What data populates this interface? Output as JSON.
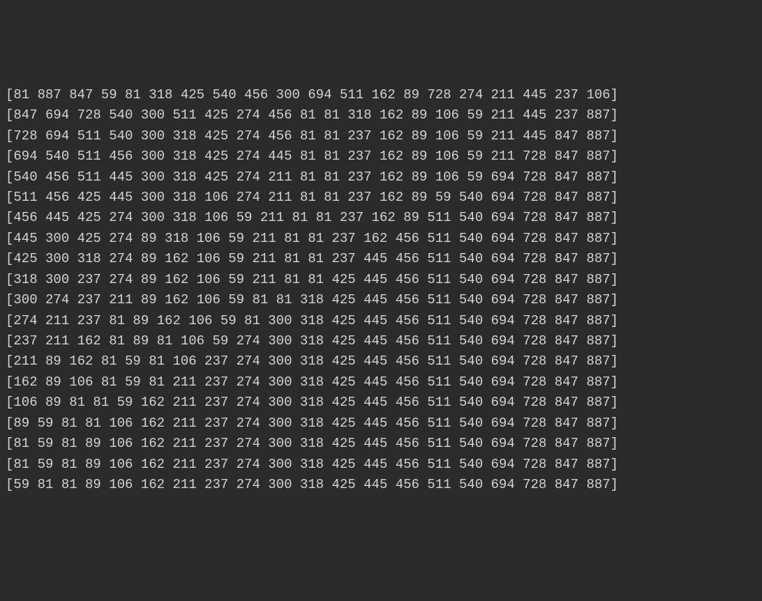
{
  "terminal": {
    "lines": [
      "[81 887 847 59 81 318 425 540 456 300 694 511 162 89 728 274 211 445 237 106]",
      "[847 694 728 540 300 511 425 274 456 81 81 318 162 89 106 59 211 445 237 887]",
      "[728 694 511 540 300 318 425 274 456 81 81 237 162 89 106 59 211 445 847 887]",
      "[694 540 511 456 300 318 425 274 445 81 81 237 162 89 106 59 211 728 847 887]",
      "[540 456 511 445 300 318 425 274 211 81 81 237 162 89 106 59 694 728 847 887]",
      "[511 456 425 445 300 318 106 274 211 81 81 237 162 89 59 540 694 728 847 887]",
      "[456 445 425 274 300 318 106 59 211 81 81 237 162 89 511 540 694 728 847 887]",
      "[445 300 425 274 89 318 106 59 211 81 81 237 162 456 511 540 694 728 847 887]",
      "[425 300 318 274 89 162 106 59 211 81 81 237 445 456 511 540 694 728 847 887]",
      "[318 300 237 274 89 162 106 59 211 81 81 425 445 456 511 540 694 728 847 887]",
      "[300 274 237 211 89 162 106 59 81 81 318 425 445 456 511 540 694 728 847 887]",
      "[274 211 237 81 89 162 106 59 81 300 318 425 445 456 511 540 694 728 847 887]",
      "[237 211 162 81 89 81 106 59 274 300 318 425 445 456 511 540 694 728 847 887]",
      "[211 89 162 81 59 81 106 237 274 300 318 425 445 456 511 540 694 728 847 887]",
      "[162 89 106 81 59 81 211 237 274 300 318 425 445 456 511 540 694 728 847 887]",
      "[106 89 81 81 59 162 211 237 274 300 318 425 445 456 511 540 694 728 847 887]",
      "[89 59 81 81 106 162 211 237 274 300 318 425 445 456 511 540 694 728 847 887]",
      "[81 59 81 89 106 162 211 237 274 300 318 425 445 456 511 540 694 728 847 887]",
      "[81 59 81 89 106 162 211 237 274 300 318 425 445 456 511 540 694 728 847 887]",
      "[59 81 81 89 106 162 211 237 274 300 318 425 445 456 511 540 694 728 847 887]"
    ]
  }
}
